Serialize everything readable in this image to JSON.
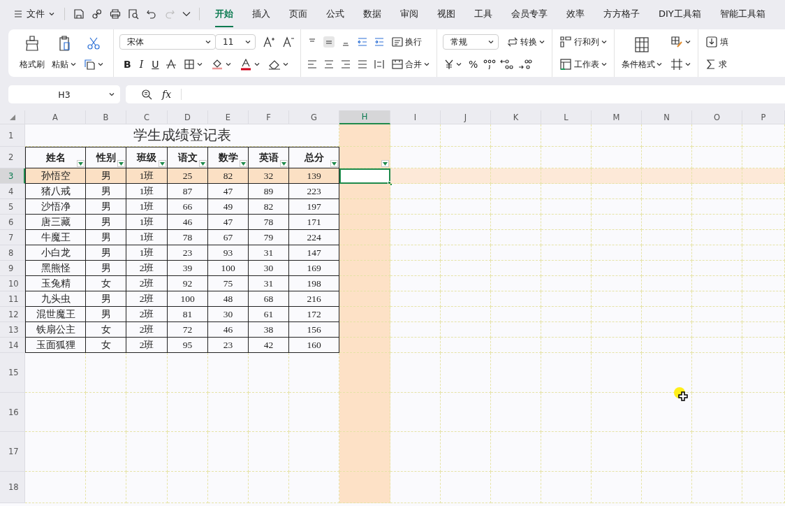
{
  "menu": {
    "label": "文件"
  },
  "tabs": [
    {
      "label": "开始",
      "selected": true
    },
    {
      "label": "插入",
      "selected": false
    },
    {
      "label": "页面",
      "selected": false
    },
    {
      "label": "公式",
      "selected": false
    },
    {
      "label": "数据",
      "selected": false
    },
    {
      "label": "审阅",
      "selected": false
    },
    {
      "label": "视图",
      "selected": false
    },
    {
      "label": "工具",
      "selected": false
    },
    {
      "label": "会员专享",
      "selected": false
    },
    {
      "label": "效率",
      "selected": false
    },
    {
      "label": "方方格子",
      "selected": false
    },
    {
      "label": "DIY工具箱",
      "selected": false
    },
    {
      "label": "智能工具箱",
      "selected": false
    }
  ],
  "ribbon": {
    "format_painter": "格式刷",
    "paste": "粘贴",
    "font_name": "宋体",
    "font_size": "11",
    "bold": "B",
    "italic": "I",
    "underline": "U",
    "wrap": "换行",
    "merge": "合并",
    "number_format": "常规",
    "convert": "转换",
    "percent": "%",
    "rows_columns": "行和列",
    "worksheet": "工作表",
    "conditional_format": "条件格式",
    "fill": "填",
    "sum": "求"
  },
  "name_box": "H3",
  "formula_bar": {
    "function_label": "fx"
  },
  "sheet": {
    "columns": [
      {
        "label": "A",
        "selected": false
      },
      {
        "label": "B",
        "selected": false
      },
      {
        "label": "C",
        "selected": false
      },
      {
        "label": "D",
        "selected": false
      },
      {
        "label": "E",
        "selected": false
      },
      {
        "label": "F",
        "selected": false
      },
      {
        "label": "G",
        "selected": false
      },
      {
        "label": "H",
        "selected": true
      },
      {
        "label": "I",
        "selected": false
      },
      {
        "label": "J",
        "selected": false
      },
      {
        "label": "K",
        "selected": false
      },
      {
        "label": "L",
        "selected": false
      },
      {
        "label": "M",
        "selected": false
      },
      {
        "label": "N",
        "selected": false
      },
      {
        "label": "O",
        "selected": false
      },
      {
        "label": "P",
        "selected": false
      }
    ],
    "rows": [
      {
        "label": "1",
        "selected": false
      },
      {
        "label": "2",
        "selected": false
      },
      {
        "label": "3",
        "selected": true
      },
      {
        "label": "4",
        "selected": false
      },
      {
        "label": "5",
        "selected": false
      },
      {
        "label": "6",
        "selected": false
      },
      {
        "label": "7",
        "selected": false
      },
      {
        "label": "8",
        "selected": false
      },
      {
        "label": "9",
        "selected": false
      },
      {
        "label": "10",
        "selected": false
      },
      {
        "label": "11",
        "selected": false
      },
      {
        "label": "12",
        "selected": false
      },
      {
        "label": "13",
        "selected": false
      },
      {
        "label": "14",
        "selected": false
      },
      {
        "label": "15",
        "selected": false
      },
      {
        "label": "16",
        "selected": false
      },
      {
        "label": "17",
        "selected": false
      },
      {
        "label": "18",
        "selected": false
      }
    ],
    "title": "学生成绩登记表",
    "headers": [
      {
        "label": "姓名",
        "filter": true
      },
      {
        "label": "性别",
        "filter": true
      },
      {
        "label": "班级",
        "filter": true
      },
      {
        "label": "语文",
        "filter": true
      },
      {
        "label": "数学",
        "filter": true
      },
      {
        "label": "英语",
        "filter": true
      },
      {
        "label": "总分",
        "filter": true
      }
    ],
    "next_column_filter": true,
    "records": [
      [
        "孙悟空",
        "男",
        "1班",
        "25",
        "82",
        "32",
        "139"
      ],
      [
        "猪八戒",
        "男",
        "1班",
        "87",
        "47",
        "89",
        "223"
      ],
      [
        "沙悟净",
        "男",
        "1班",
        "66",
        "49",
        "82",
        "197"
      ],
      [
        "唐三藏",
        "男",
        "1班",
        "46",
        "47",
        "78",
        "171"
      ],
      [
        "牛魔王",
        "男",
        "1班",
        "78",
        "67",
        "79",
        "224"
      ],
      [
        "小白龙",
        "男",
        "1班",
        "23",
        "93",
        "31",
        "147"
      ],
      [
        "黑熊怪",
        "男",
        "2班",
        "39",
        "100",
        "30",
        "169"
      ],
      [
        "玉兔精",
        "女",
        "2班",
        "92",
        "75",
        "31",
        "198"
      ],
      [
        "九头虫",
        "男",
        "2班",
        "100",
        "48",
        "68",
        "216"
      ],
      [
        "混世魔王",
        "男",
        "2班",
        "81",
        "30",
        "61",
        "172"
      ],
      [
        "铁扇公主",
        "女",
        "2班",
        "72",
        "46",
        "38",
        "156"
      ],
      [
        "玉面狐狸",
        "女",
        "2班",
        "95",
        "23",
        "42",
        "160"
      ]
    ]
  }
}
